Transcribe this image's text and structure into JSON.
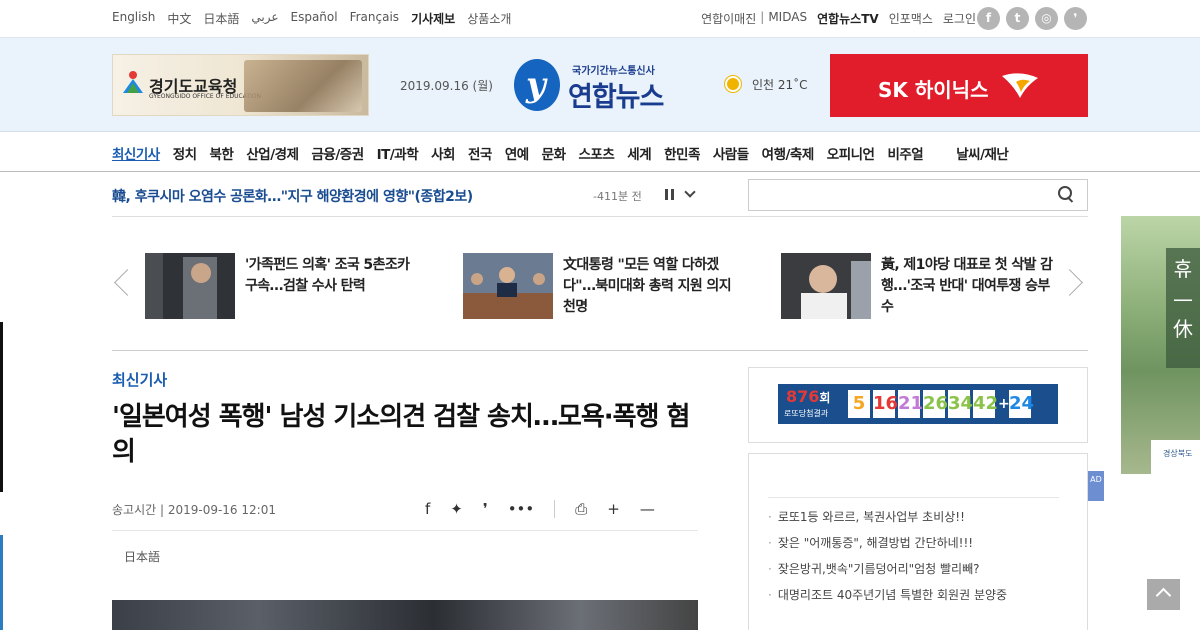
{
  "topbar": {
    "languages": [
      "English",
      "中文",
      "日本語",
      "عربي",
      "Español",
      "Français"
    ],
    "links": [
      "기사제보",
      "상품소개"
    ],
    "util_links": [
      "연합이매진",
      "MIDAS",
      "연합뉴스TV",
      "인포맥스",
      "로그인"
    ],
    "social_icons": [
      "facebook-icon",
      "twitter-icon",
      "instagram-icon",
      "story-icon"
    ]
  },
  "header": {
    "ad_left": {
      "title": "경기도교육청",
      "subtitle": "GYEONGGIDO OFFICE OF EDUCATION"
    },
    "date": "2019.09.16 (월)",
    "logo": {
      "tagline": "국가기간뉴스통신사",
      "name": "연합뉴스"
    },
    "weather": {
      "icon": "sun-icon",
      "text": "인천 21˚C"
    },
    "ad_right": {
      "text": "SK 하이닉스"
    }
  },
  "nav": {
    "items": [
      "최신기사",
      "정치",
      "북한",
      "산업/경제",
      "금융/증권",
      "IT/과학",
      "사회",
      "전국",
      "연예",
      "문화",
      "스포츠",
      "세계",
      "한민족",
      "사람들",
      "여행/축제",
      "오피니언",
      "비주얼",
      "날씨/재난"
    ]
  },
  "breaking": {
    "headline": "韓, 후쿠시마 오염수 공론화…\"지구 해양환경에 영향\"(종합2보)",
    "time": "-411분 전"
  },
  "search": {
    "placeholder": ""
  },
  "carousel": [
    {
      "title": "'가족펀드 의혹' 조국 5촌조카 구속…검찰 수사 탄력"
    },
    {
      "title": "文대통령 \"모든 역할 다하겠다\"…북미대화 총력 지원 의지 천명"
    },
    {
      "title": "黃, 제1야당 대표로 첫 삭발 감행…'조국 반대' 대여투쟁 승부수"
    }
  ],
  "article": {
    "section": "최신기사",
    "title": "'일본여성 폭행' 남성 기소의견 검찰 송치…모욕·폭행 혐의",
    "meta": "송고시간 | 2019-09-16 12:01",
    "language_link": "日本語"
  },
  "lotto": {
    "round": "876",
    "round_suffix": "회",
    "label": "로또당첨결과",
    "numbers": [
      "5",
      "16",
      "21",
      "26",
      "34",
      "42"
    ],
    "plus": "+",
    "bonus": "24",
    "colors": [
      "#f5a623",
      "#e53935",
      "#c37ad6",
      "#8bc34a",
      "#8bc34a",
      "#8bc34a",
      "#1e88e5"
    ]
  },
  "ad_list": [
    "로또1등 와르르, 복권사업부 초비상!!",
    "잦은 \"어깨통증\", 해결방법 간단하네!!!",
    "잦은방귀,뱃속\"기름덩어리\"엄청 빨리빼?",
    "대명리조트 40주년기념 특별한 회원권 분양중"
  ],
  "ad_tag": "AD",
  "side_banner": {
    "vertical_text": "휴 — 休",
    "footer": "경상북도"
  }
}
